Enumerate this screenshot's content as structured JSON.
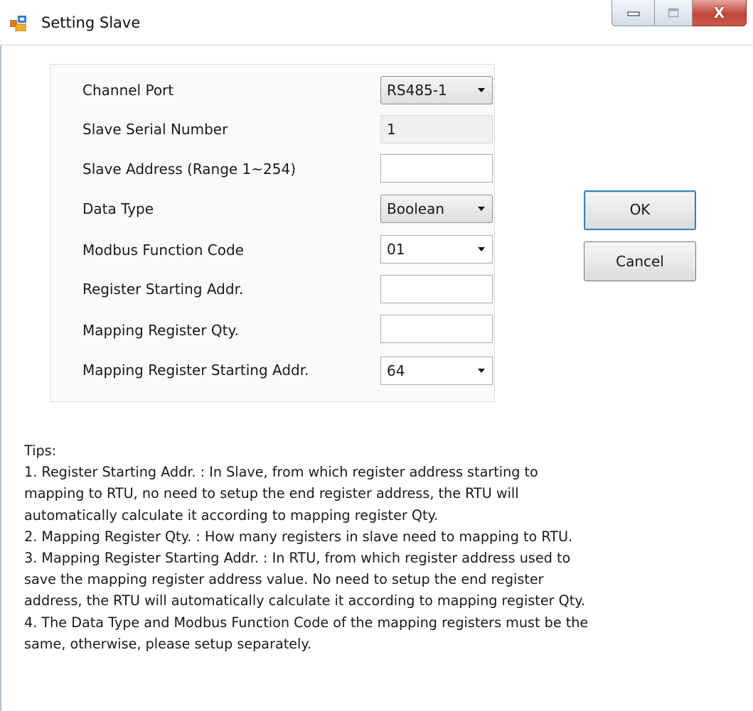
{
  "window": {
    "title": "Setting Slave",
    "minimize_icon": "minimize-icon",
    "maximize_icon": "maximize-icon",
    "close_icon": "close-icon",
    "close_glyph": "X"
  },
  "form": {
    "channel_port": {
      "label": "Channel Port",
      "value": "RS485-1"
    },
    "slave_serial_number": {
      "label": "Slave Serial Number",
      "value": "1"
    },
    "slave_address": {
      "label": "Slave Address (Range 1~254)",
      "value": ""
    },
    "data_type": {
      "label": "Data Type",
      "value": "Boolean"
    },
    "modbus_function_code": {
      "label": "Modbus Function Code",
      "value": "01"
    },
    "register_starting_addr": {
      "label": "Register Starting Addr.",
      "value": ""
    },
    "mapping_register_qty": {
      "label": "Mapping Register Qty.",
      "value": ""
    },
    "mapping_register_starting_addr": {
      "label": "Mapping Register Starting Addr.",
      "value": "64"
    }
  },
  "buttons": {
    "ok": "OK",
    "cancel": "Cancel"
  },
  "tips": {
    "heading": "Tips:",
    "lines": [
      "1. Register Starting Addr. : In Slave, from which register address starting to",
      "mapping to RTU, no need to setup the end register address, the RTU will",
      "automatically calculate it according to mapping register Qty.",
      "2. Mapping Register Qty. : How many registers in slave need to mapping to RTU.",
      "3. Mapping Register Starting Addr. : In RTU, from which register address used to",
      "save the mapping register address value. No need to setup the end register",
      "address, the RTU will automatically calculate it according to mapping register Qty.",
      "4. The Data Type and Modbus Function Code of the mapping registers must be the",
      "same, otherwise, please setup separately."
    ]
  },
  "colors": {
    "accent": "#3c7fb1",
    "close_button": "#c3443a",
    "groupbox_bg": "#fafafa"
  }
}
